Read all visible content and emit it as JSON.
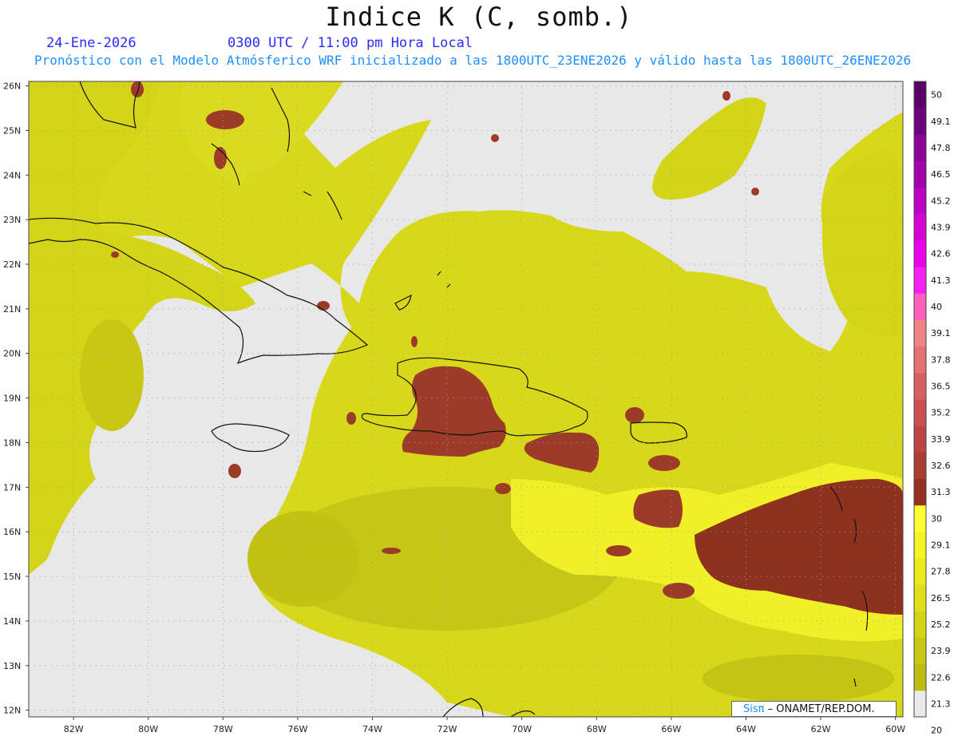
{
  "header": {
    "title": "Indice K (C, somb.)",
    "date": "24-Ene-2026",
    "time": "0300 UTC / 11:00 pm Hora Local",
    "info": "Pronóstico con el Modelo Atmósferico WRF inicializado a las 1800UTC_23ENE2026 y válido hasta las  1800UTC_26ENE2026"
  },
  "map": {
    "lon_range": [
      -83.2,
      -59.8
    ],
    "lat_range": [
      11.85,
      26.1
    ],
    "lat_labels": [
      "26N",
      "25N",
      "24N",
      "23N",
      "22N",
      "21N",
      "20N",
      "19N",
      "18N",
      "17N",
      "16N",
      "15N",
      "14N",
      "13N",
      "12N"
    ],
    "lat_values": [
      26,
      25,
      24,
      23,
      22,
      21,
      20,
      19,
      18,
      17,
      16,
      15,
      14,
      13,
      12
    ],
    "lon_labels": [
      "82W",
      "80W",
      "78W",
      "76W",
      "74W",
      "72W",
      "70W",
      "68W",
      "66W",
      "64W",
      "62W",
      "60W"
    ],
    "lon_values": [
      -82,
      -80,
      -78,
      -76,
      -74,
      -72,
      -70,
      -68,
      -66,
      -64,
      -62,
      -60
    ],
    "background_color": "#e8e8e8"
  },
  "colorbar": {
    "levels": [
      "50",
      "49.1",
      "47.8",
      "46.5",
      "45.2",
      "43.9",
      "42.6",
      "41.3",
      "40",
      "39.1",
      "37.8",
      "36.5",
      "35.2",
      "33.9",
      "32.6",
      "31.3",
      "30",
      "29.1",
      "27.8",
      "26.5",
      "25.2",
      "23.9",
      "22.6",
      "21.3",
      "20"
    ],
    "colors": [
      "#5a0066",
      "#6e007e",
      "#8a0096",
      "#a200ae",
      "#bd00c4",
      "#d600d6",
      "#ea00ea",
      "#f620f6",
      "#ff5fbd",
      "#f08484",
      "#e57070",
      "#d96060",
      "#cc5050",
      "#be4444",
      "#aa3c30",
      "#94301e",
      "#ffff33",
      "#f4f420",
      "#eaea1c",
      "#dfdf1a",
      "#d4d416",
      "#c8c814",
      "#bcbc12",
      "#eaeaea"
    ]
  },
  "credit": {
    "brand": "Sisπ",
    "org": "– ONAMET/REP.DOM."
  }
}
